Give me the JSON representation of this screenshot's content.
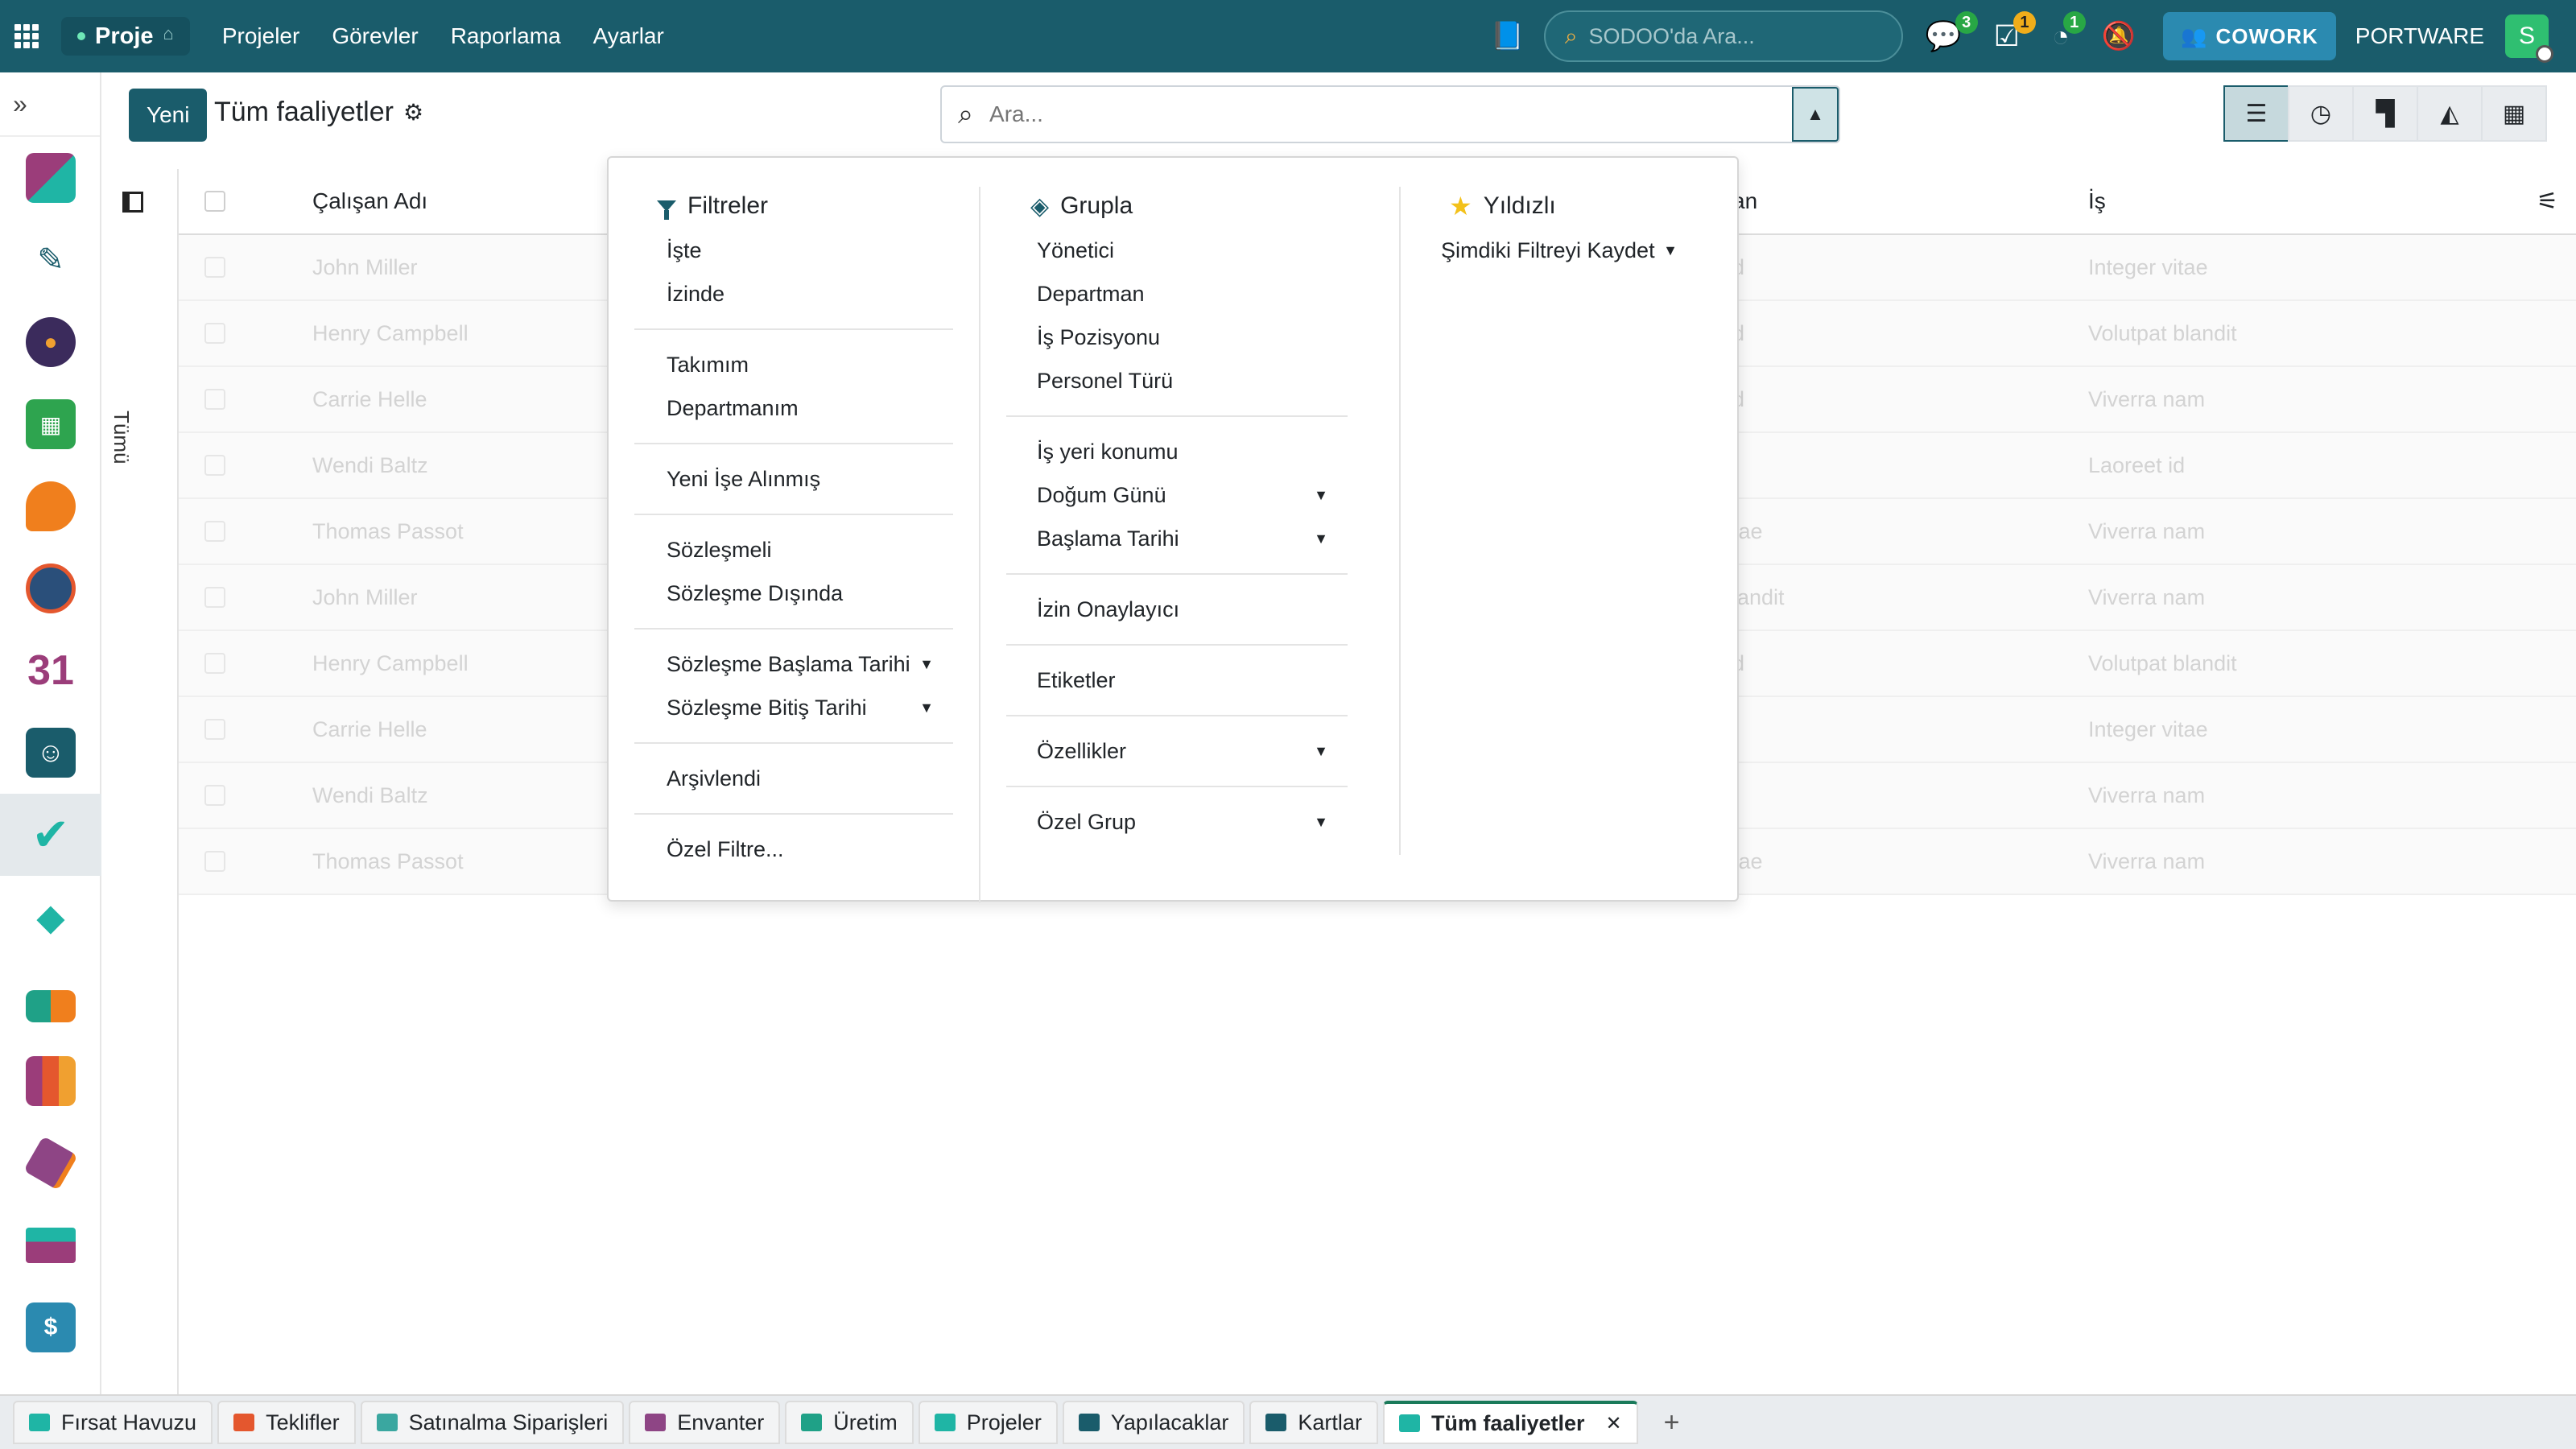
{
  "topbar": {
    "app_name": "Proje",
    "menu": [
      "Projeler",
      "Görevler",
      "Raporlama",
      "Ayarlar"
    ],
    "search_placeholder": "SODOO'da Ara...",
    "badges": {
      "chat": "3",
      "activity": "1",
      "timer": "1"
    },
    "cowork_label": "COWORK",
    "company": "PORTWARE",
    "avatar_letter": "S"
  },
  "control_panel": {
    "new_label": "Yeni",
    "title": "Tüm faaliyetler",
    "search_placeholder": "Ara..."
  },
  "sidepanel": {
    "label": "Tümü"
  },
  "list": {
    "columns": {
      "name": "Çalışan Adı",
      "middle": "an",
      "job": "İş"
    },
    "rows": [
      {
        "name": "John Miller",
        "mid": "d",
        "job": "Integer vitae"
      },
      {
        "name": "Henry Campbell",
        "mid": "d",
        "job": "Volutpat blandit"
      },
      {
        "name": "Carrie Helle",
        "mid": "d",
        "job": "Viverra nam"
      },
      {
        "name": "Wendi Baltz",
        "mid": "",
        "job": "Laoreet id"
      },
      {
        "name": "Thomas Passot",
        "mid": "tae",
        "job": "Viverra nam"
      },
      {
        "name": "John Miller",
        "mid": "landit",
        "job": "Viverra nam"
      },
      {
        "name": "Henry Campbell",
        "mid": "d",
        "job": "Volutpat blandit"
      },
      {
        "name": "Carrie Helle",
        "mid": "",
        "job": "Integer vitae"
      },
      {
        "name": "Wendi Baltz",
        "mid": "",
        "job": "Viverra nam"
      },
      {
        "name": "Thomas Passot",
        "mid": "tae",
        "job": "Viverra nam"
      }
    ]
  },
  "dropdown": {
    "filters": {
      "title": "Filtreler",
      "groups": [
        [
          "İşte",
          "İzinde"
        ],
        [
          "Takımım",
          "Departmanım"
        ],
        [
          "Yeni İşe Alınmış"
        ],
        [
          "Sözleşmeli",
          "Sözleşme Dışında"
        ],
        [
          "Sözleşme Başlama Tarihi",
          "Sözleşme Bitiş Tarihi"
        ],
        [
          "Arşivlendi"
        ],
        [
          "Özel Filtre..."
        ]
      ]
    },
    "groupby": {
      "title": "Grupla",
      "groups": [
        [
          "Yönetici",
          "Departman",
          "İş Pozisyonu",
          "Personel Türü"
        ],
        [
          "İş yeri konumu",
          "Doğum Günü",
          "Başlama Tarihi"
        ],
        [
          "İzin Onaylayıcı"
        ],
        [
          "Etiketler"
        ],
        [
          "Özellikler"
        ],
        [
          "Özel Grup"
        ]
      ]
    },
    "favorites": {
      "title": "Yıldızlı",
      "save_label": "Şimdiki Filtreyi Kaydet"
    }
  },
  "tabs": [
    {
      "label": "Fırsat Havuzu",
      "color": "#1fb5a5"
    },
    {
      "label": "Teklifler",
      "color": "#e4572e"
    },
    {
      "label": "Satınalma Siparişleri",
      "color": "#3aa7a0"
    },
    {
      "label": "Envanter",
      "color": "#8e4585"
    },
    {
      "label": "Üretim",
      "color": "#1fa187"
    },
    {
      "label": "Projeler",
      "color": "#1fb5a5"
    },
    {
      "label": "Yapılacaklar",
      "color": "#1a5c6b"
    },
    {
      "label": "Kartlar",
      "color": "#1a5c6b"
    },
    {
      "label": "Tüm faaliyetler",
      "color": "#1fb5a5"
    }
  ]
}
